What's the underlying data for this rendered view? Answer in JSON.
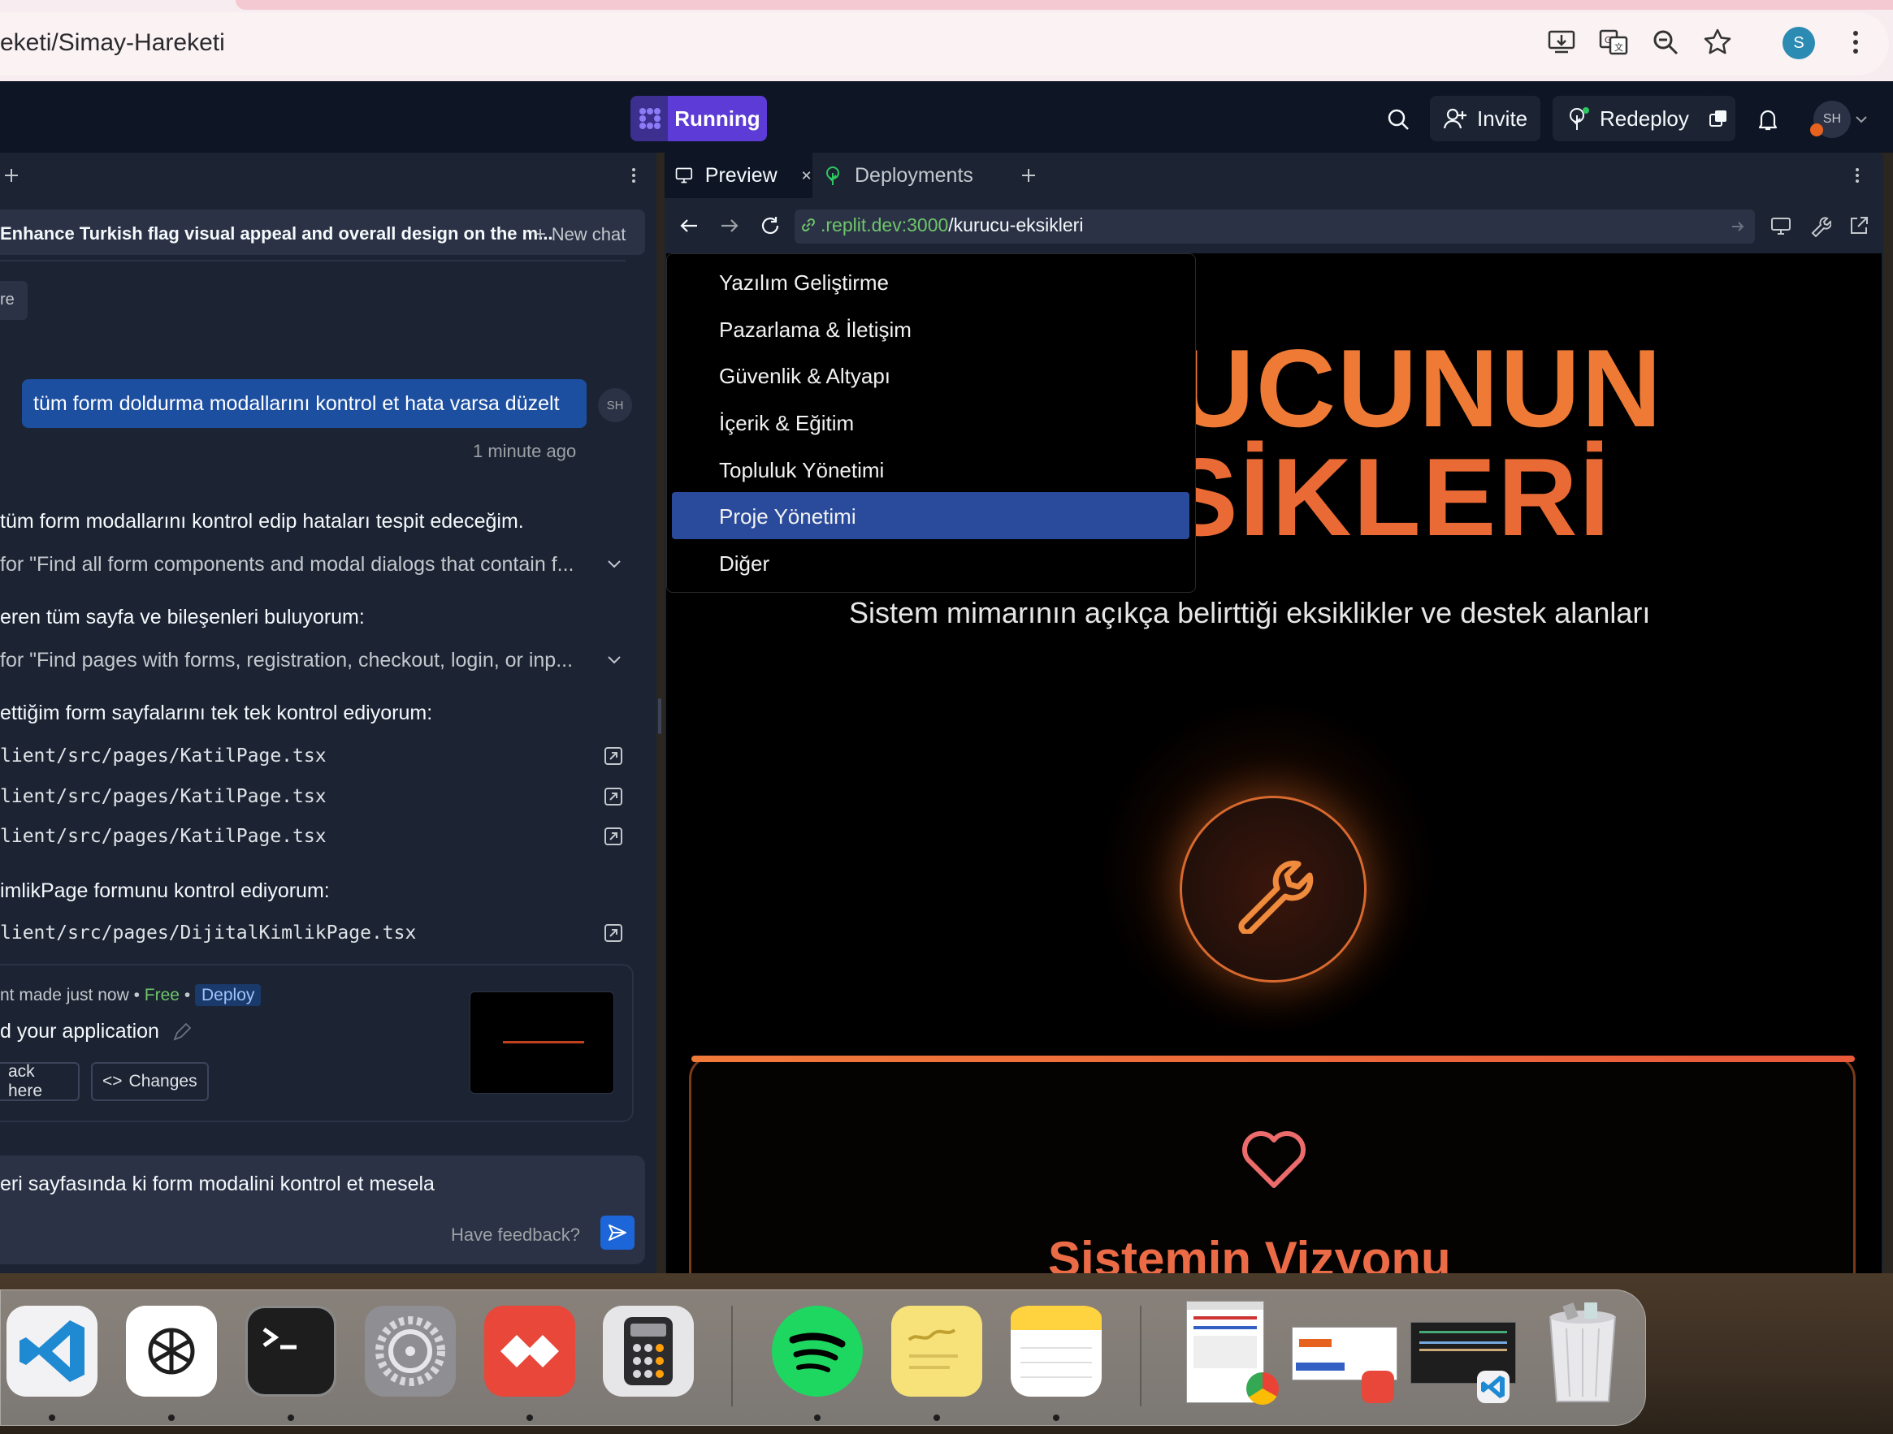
{
  "browser": {
    "url": "eketi/Simay-Hareketi",
    "profile_initial": "S"
  },
  "topbar": {
    "status_label": "Running",
    "invite_label": "Invite",
    "redeploy_label": "Redeploy",
    "avatar_initials": "SH"
  },
  "agent": {
    "chat_title": "Enhance Turkish flag visual appeal and overall design on the m...",
    "new_chat_label": "New chat",
    "more_chip": "re",
    "user_message": "tüm form doldurma modallarını kontrol et hata varsa düzelt",
    "user_initials": "SH",
    "time_ago": "1 minute ago",
    "lines": [
      "tüm form modallarını kontrol edip hataları tespit edeceğim.",
      "for \"Find all form components and modal dialogs that contain f...",
      "eren tüm sayfa ve bileşenleri buluyorum:",
      "for \"Find pages with forms, registration, checkout, login, or inp...",
      "ettiğim form sayfalarını tek tek kontrol ediyorum:",
      "lient/src/pages/KatilPage.tsx",
      "lient/src/pages/KatilPage.tsx",
      "lient/src/pages/KatilPage.tsx",
      "imlikPage formunu kontrol ediyorum:",
      "lient/src/pages/DijitalKimlikPage.tsx"
    ],
    "checkpoint": {
      "meta_prefix": "nt made just now",
      "free_label": "Free",
      "deploy_label": "Deploy",
      "title": "d your application",
      "rollback_label": "ack here",
      "changes_label": "Changes"
    },
    "input_text": "eri sayfasında ki form modalini kontrol et mesela",
    "feedback_label": "Have feedback?"
  },
  "preview": {
    "tab_preview": "Preview",
    "tab_deployments": "Deployments",
    "address_host": ".replit.dev:3000",
    "address_path": "/kurucu-eksikleri",
    "hero_line1": "KURUCUNUN",
    "hero_line2": "EKSİKLERİ",
    "hero_subtitle": "Sistem mimarının açıkça belirttiği eksiklikler ve destek alanları",
    "card_title": "Sistemin Vizyonu",
    "dropdown_options": [
      "Yazılım Geliştirme",
      "Pazarlama & İletişim",
      "Güvenlik & Altyapı",
      "İçerik & Eğitim",
      "Topluluk Yönetimi",
      "Proje Yönetimi",
      "Diğer"
    ],
    "dropdown_selected": "Proje Yönetimi"
  },
  "dock": {
    "apps": [
      "vscode-icon",
      "chatgpt-icon",
      "terminal-icon",
      "system-settings-icon",
      "anydesk-icon",
      "calculator-icon",
      "spotify-icon",
      "stickies-icon",
      "notes-icon",
      "chrome-window-thumb",
      "anydesk-window-thumb",
      "vscode-window-thumb",
      "trash-icon"
    ]
  },
  "colors": {
    "replit_bg": "#0e1525",
    "panel_bg": "#1c2333",
    "running_purple": "#5d3bd6",
    "user_bubble": "#1d4fa1",
    "hero_orange": "#ee7a35",
    "dropdown_highlight": "#2a4a9c"
  }
}
